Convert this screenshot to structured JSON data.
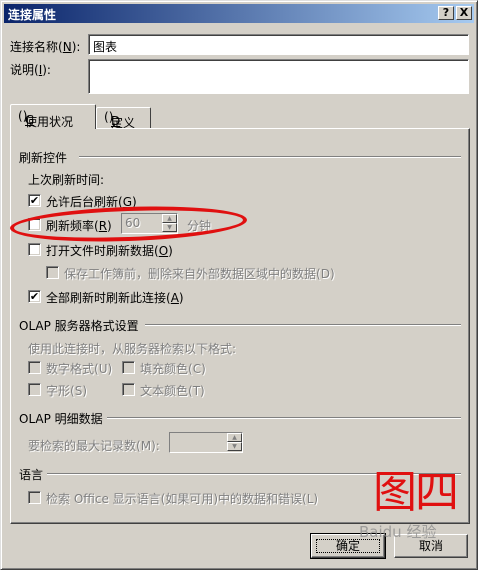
{
  "window": {
    "title": "连接属性",
    "help_btn": "?",
    "close_btn": "X"
  },
  "connection_name": {
    "label": "连接名称",
    "key": "N",
    "value": "图表"
  },
  "description": {
    "label": "说明",
    "key": "I",
    "value": ""
  },
  "tabs": [
    {
      "label": "使用状况",
      "key": "G",
      "active": true
    },
    {
      "label": "定义",
      "key": "D",
      "active": false
    }
  ],
  "refresh": {
    "group": "刷新控件",
    "last_refresh": "上次刷新时间:",
    "background": {
      "label": "允许后台刷新",
      "key": "G",
      "checked": true
    },
    "interval": {
      "label": "刷新频率",
      "key": "R",
      "checked": false,
      "value": "60",
      "unit": "分钟"
    },
    "on_open": {
      "label": "打开文件时刷新数据",
      "key": "O",
      "checked": false
    },
    "remove_data": {
      "label": "保存工作簿前，删除来自外部数据区域中的数据",
      "key": "D",
      "checked": false
    },
    "refresh_all": {
      "label": "全部刷新时刷新此连接",
      "key": "A",
      "checked": true
    }
  },
  "olap_format": {
    "group": "OLAP 服务器格式设置",
    "desc": "使用此连接时，从服务器检索以下格式:",
    "number_format": {
      "label": "数字格式",
      "key": "U"
    },
    "fill_color": {
      "label": "填充颜色",
      "key": "C"
    },
    "font_style": {
      "label": "字形",
      "key": "S"
    },
    "text_color": {
      "label": "文本颜色",
      "key": "T"
    }
  },
  "olap_drill": {
    "group": "OLAP 明细数据",
    "max_records": {
      "label": "要检索的最大记录数",
      "key": "M",
      "value": ""
    }
  },
  "language": {
    "group": "语言",
    "retrieve": {
      "label": "检索 Office 显示语言(如果可用)中的数据和错误",
      "key": "L"
    }
  },
  "buttons": {
    "ok": "确定",
    "cancel": "取消"
  },
  "annotation": {
    "text": "图四",
    "color": "#e01010"
  },
  "watermark": "Baidu 经验",
  "colors": {
    "titlebar_start": "#0a246a",
    "titlebar_end": "#a6caf0",
    "face": "#d4d0c8",
    "annotation": "#e01010"
  }
}
